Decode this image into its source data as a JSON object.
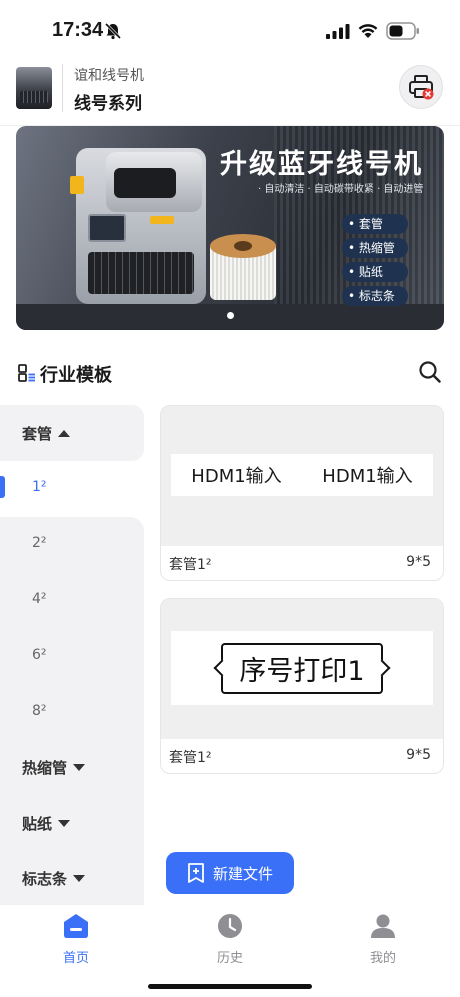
{
  "status_bar": {
    "time": "17:34"
  },
  "header": {
    "brand_sub": "谊和线号机",
    "brand_title": "线号系列"
  },
  "banner": {
    "title": "升级蓝牙线号机",
    "subtitle": "· 自动清洁 · 自动碳带收紧 · 自动进管",
    "features": [
      "• 套管",
      "• 热缩管",
      "• 贴纸",
      "• 标志条"
    ]
  },
  "section": {
    "title": "行业模板"
  },
  "sidebar": {
    "categories": [
      {
        "label": "套管",
        "expanded": true,
        "items": [
          {
            "label": "1²",
            "selected": true
          },
          {
            "label": "2²"
          },
          {
            "label": "4²"
          },
          {
            "label": "6²"
          },
          {
            "label": "8²"
          }
        ]
      },
      {
        "label": "热缩管",
        "expanded": false
      },
      {
        "label": "贴纸",
        "expanded": false
      },
      {
        "label": "标志条",
        "expanded": false
      }
    ]
  },
  "cards": [
    {
      "preview_texts": [
        "HDM1输入",
        "HDM1输入"
      ],
      "name": "套管1²",
      "size": "9*5"
    },
    {
      "preview_texts": [
        "序号打印1"
      ],
      "name": "套管1²",
      "size": "9*5"
    }
  ],
  "fab": {
    "label": "新建文件"
  },
  "tabbar": {
    "tabs": [
      {
        "label": "首页",
        "active": true
      },
      {
        "label": "历史",
        "active": false
      },
      {
        "label": "我的",
        "active": false
      }
    ]
  },
  "colors": {
    "accent": "#3a6ff7",
    "sidebar_bg": "#f2f2f4",
    "card_preview_bg": "#efefef",
    "inactive": "#8e8e93"
  }
}
